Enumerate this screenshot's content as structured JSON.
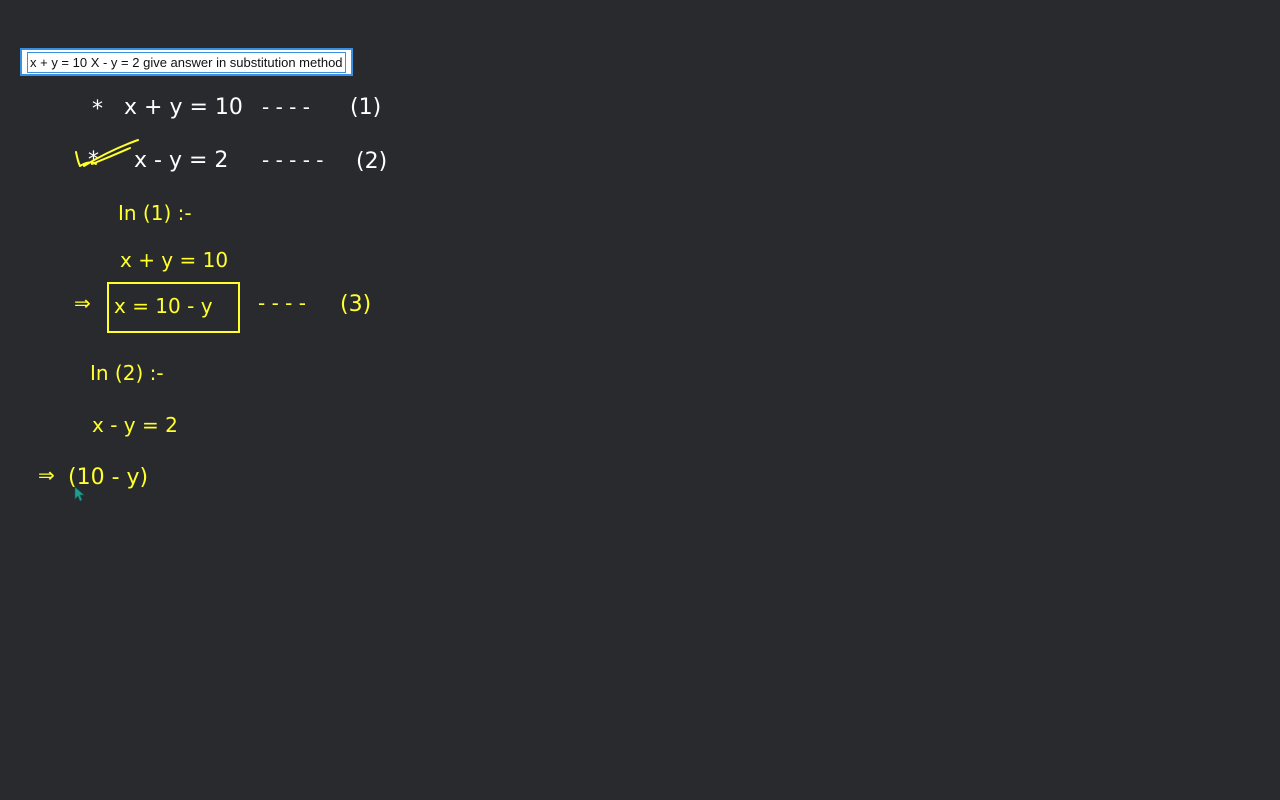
{
  "question": {
    "text": "x + y = 10 X - y = 2 give answer in substitution method"
  },
  "board": {
    "colors": {
      "background": "#292a2d",
      "ink_white": "#ffffff",
      "ink_yellow": "#ffff2e",
      "question_border": "#3b8fe0"
    },
    "lines": {
      "eq1": {
        "bullet": "*",
        "expression": "x + y = 10",
        "leader": "- - - -",
        "tag": "(1)"
      },
      "eq2": {
        "bullet": "*",
        "expression": "x - y = 2",
        "leader": "- - - - -",
        "tag": "(2)"
      },
      "step_in1": {
        "text": "In (1) :-"
      },
      "step_eq1_copy": {
        "text": "x + y = 10"
      },
      "step_result": {
        "arrow": "⇒",
        "expression": "x = 10 - y",
        "leader": "- - - -",
        "tag": "(3)"
      },
      "step_in2": {
        "text": "In (2) :-"
      },
      "step_eq2_copy": {
        "text": "x - y = 2"
      },
      "step_substitute": {
        "arrow": "⇒",
        "expression": "(10 - y)"
      }
    },
    "pointer": {
      "icon": "cursor-arrow-icon",
      "color": "#1f9e8e"
    }
  }
}
